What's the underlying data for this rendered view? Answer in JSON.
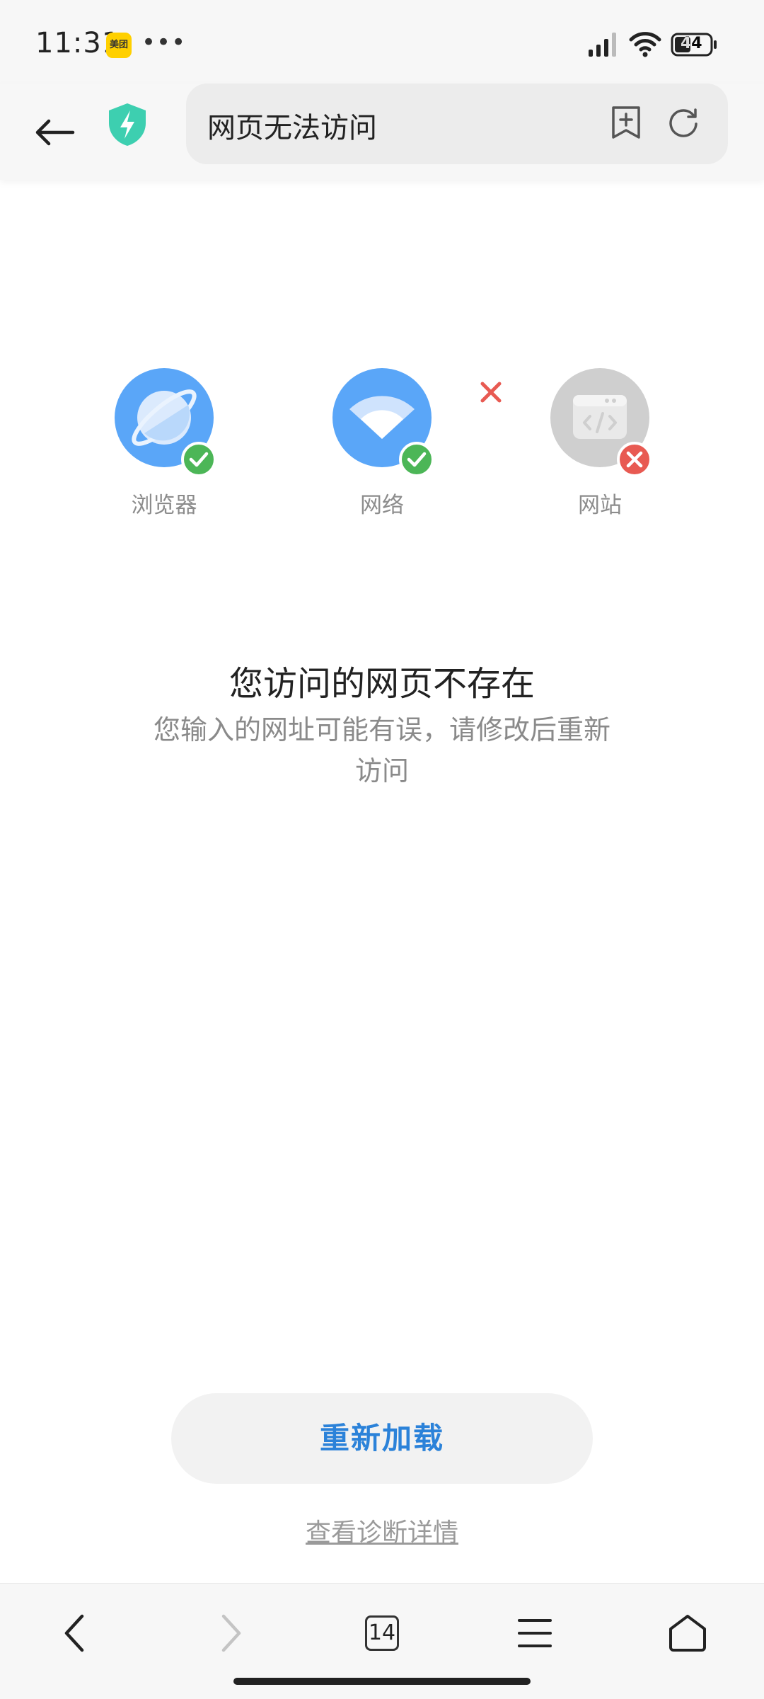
{
  "status_bar": {
    "time": "11:31",
    "app_badge": "美团",
    "more": "•••",
    "battery": "44"
  },
  "toolbar": {
    "back_icon": "arrow-left-icon",
    "shield_icon": "security-shield-icon",
    "url_text": "网页无法访问",
    "bookmark_icon": "add-bookmark-icon",
    "reload_icon": "reload-icon"
  },
  "diagnostics": [
    {
      "label": "浏览器",
      "status": "ok",
      "color": "#5aa6f8"
    },
    {
      "label": "网络",
      "status": "ok",
      "color": "#5aa6f8"
    },
    {
      "label": "网站",
      "status": "error",
      "color": "#cfcfcf"
    }
  ],
  "colors": {
    "ok_badge": "#4cb657",
    "error_badge": "#e85a52",
    "accent": "#2b82d9"
  },
  "message": {
    "title": "您访问的网页不存在",
    "description": "您输入的网址可能有误，请修改后重新访问"
  },
  "actions": {
    "reload_label": "重新加载",
    "diagnose_label": "查看诊断详情"
  },
  "bottom_nav": {
    "tab_count": "14"
  }
}
